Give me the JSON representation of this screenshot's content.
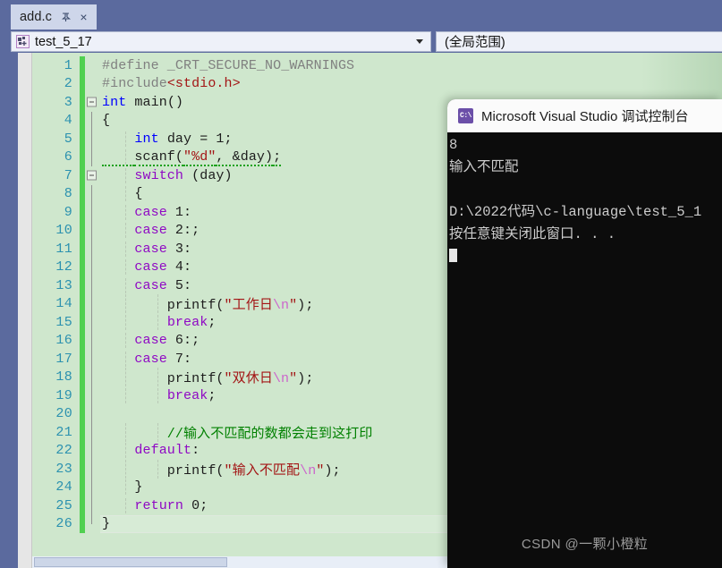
{
  "tab": {
    "label": "add.c",
    "pin_icon": "pin-icon",
    "close_icon": "close-icon",
    "close_glyph": "×"
  },
  "navbar": {
    "project": {
      "value": "test_5_17",
      "icon": "project-node-icon",
      "caret_icon": "chevron-down-icon"
    },
    "scope": {
      "value": "(全局范围)"
    }
  },
  "editor": {
    "lines": [
      {
        "n": "1",
        "tokens": [
          {
            "t": "#define _CRT_SECURE_NO_WARNINGS",
            "c": "c-pre"
          }
        ]
      },
      {
        "n": "2",
        "tokens": [
          {
            "t": "#include",
            "c": "c-pre"
          },
          {
            "t": "<stdio.h>",
            "c": "c-inc"
          }
        ]
      },
      {
        "n": "3",
        "tokens": [
          {
            "t": "int",
            "c": "c-kw"
          },
          {
            "t": " main()",
            "c": "c-plain"
          }
        ]
      },
      {
        "n": "4",
        "tokens": [
          {
            "t": "{",
            "c": "c-plain"
          }
        ]
      },
      {
        "n": "5",
        "tokens": [
          {
            "t": "    ",
            "c": "c-plain"
          },
          {
            "t": "int",
            "c": "c-kw"
          },
          {
            "t": " day = 1;",
            "c": "c-plain"
          }
        ]
      },
      {
        "n": "6",
        "tokens": [
          {
            "t": "    ",
            "c": "c-plain"
          },
          {
            "t": "scanf(",
            "c": "c-plain"
          },
          {
            "t": "\"%d\"",
            "c": "c-str"
          },
          {
            "t": ", &day)",
            "c": "c-plain"
          },
          {
            "t": ";",
            "c": "c-plain"
          }
        ]
      },
      {
        "n": "7",
        "tokens": [
          {
            "t": "    ",
            "c": "c-plain"
          },
          {
            "t": "switch",
            "c": "c-kw2"
          },
          {
            "t": " (day)",
            "c": "c-plain"
          }
        ]
      },
      {
        "n": "8",
        "tokens": [
          {
            "t": "    {",
            "c": "c-plain"
          }
        ]
      },
      {
        "n": "9",
        "tokens": [
          {
            "t": "    ",
            "c": "c-plain"
          },
          {
            "t": "case",
            "c": "c-kw2"
          },
          {
            "t": " 1:",
            "c": "c-plain"
          }
        ]
      },
      {
        "n": "10",
        "tokens": [
          {
            "t": "    ",
            "c": "c-plain"
          },
          {
            "t": "case",
            "c": "c-kw2"
          },
          {
            "t": " 2:;",
            "c": "c-plain"
          }
        ]
      },
      {
        "n": "11",
        "tokens": [
          {
            "t": "    ",
            "c": "c-plain"
          },
          {
            "t": "case",
            "c": "c-kw2"
          },
          {
            "t": " 3:",
            "c": "c-plain"
          }
        ]
      },
      {
        "n": "12",
        "tokens": [
          {
            "t": "    ",
            "c": "c-plain"
          },
          {
            "t": "case",
            "c": "c-kw2"
          },
          {
            "t": " 4:",
            "c": "c-plain"
          }
        ]
      },
      {
        "n": "13",
        "tokens": [
          {
            "t": "    ",
            "c": "c-plain"
          },
          {
            "t": "case",
            "c": "c-kw2"
          },
          {
            "t": " 5:",
            "c": "c-plain"
          }
        ]
      },
      {
        "n": "14",
        "tokens": [
          {
            "t": "        printf(",
            "c": "c-plain"
          },
          {
            "t": "\"工作日",
            "c": "c-str"
          },
          {
            "t": "\\n",
            "c": "c-esc"
          },
          {
            "t": "\"",
            "c": "c-str"
          },
          {
            "t": ");",
            "c": "c-plain"
          }
        ]
      },
      {
        "n": "15",
        "tokens": [
          {
            "t": "        ",
            "c": "c-plain"
          },
          {
            "t": "break",
            "c": "c-kw2"
          },
          {
            "t": ";",
            "c": "c-plain"
          }
        ]
      },
      {
        "n": "16",
        "tokens": [
          {
            "t": "    ",
            "c": "c-plain"
          },
          {
            "t": "case",
            "c": "c-kw2"
          },
          {
            "t": " 6:;",
            "c": "c-plain"
          }
        ]
      },
      {
        "n": "17",
        "tokens": [
          {
            "t": "    ",
            "c": "c-plain"
          },
          {
            "t": "case",
            "c": "c-kw2"
          },
          {
            "t": " 7:",
            "c": "c-plain"
          }
        ]
      },
      {
        "n": "18",
        "tokens": [
          {
            "t": "        printf(",
            "c": "c-plain"
          },
          {
            "t": "\"双休日",
            "c": "c-str"
          },
          {
            "t": "\\n",
            "c": "c-esc"
          },
          {
            "t": "\"",
            "c": "c-str"
          },
          {
            "t": ");",
            "c": "c-plain"
          }
        ]
      },
      {
        "n": "19",
        "tokens": [
          {
            "t": "        ",
            "c": "c-plain"
          },
          {
            "t": "break",
            "c": "c-kw2"
          },
          {
            "t": ";",
            "c": "c-plain"
          }
        ]
      },
      {
        "n": "20",
        "tokens": [
          {
            "t": "",
            "c": "c-plain"
          }
        ]
      },
      {
        "n": "21",
        "tokens": [
          {
            "t": "        //输入不匹配的数都会走到这打印",
            "c": "c-cmt"
          }
        ]
      },
      {
        "n": "22",
        "tokens": [
          {
            "t": "    ",
            "c": "c-plain"
          },
          {
            "t": "default",
            "c": "c-kw2"
          },
          {
            "t": ":",
            "c": "c-plain"
          }
        ]
      },
      {
        "n": "23",
        "tokens": [
          {
            "t": "        printf(",
            "c": "c-plain"
          },
          {
            "t": "\"输入不匹配",
            "c": "c-str"
          },
          {
            "t": "\\n",
            "c": "c-esc"
          },
          {
            "t": "\"",
            "c": "c-str"
          },
          {
            "t": ");",
            "c": "c-plain"
          }
        ]
      },
      {
        "n": "24",
        "tokens": [
          {
            "t": "    }",
            "c": "c-plain"
          }
        ]
      },
      {
        "n": "25",
        "tokens": [
          {
            "t": "    ",
            "c": "c-plain"
          },
          {
            "t": "return",
            "c": "c-kw2"
          },
          {
            "t": " 0;",
            "c": "c-plain"
          }
        ]
      },
      {
        "n": "26",
        "tokens": [
          {
            "t": "}",
            "c": "c-plain"
          }
        ]
      }
    ]
  },
  "console": {
    "title": "Microsoft Visual Studio 调试控制台",
    "icon_label": "C:\\",
    "lines": [
      "8",
      "输入不匹配",
      "",
      "D:\\2022代码\\c-language\\test_5_1",
      "按任意键关闭此窗口. . ."
    ]
  },
  "watermark": {
    "text": "CSDN @一颗小橙粒"
  },
  "colors": {
    "chrome": "#5b6a9e",
    "editor_bg": "#cfe7cd",
    "change_bar": "#50d050",
    "console_bg": "#0c0c0c",
    "linenum": "#2b91af"
  }
}
